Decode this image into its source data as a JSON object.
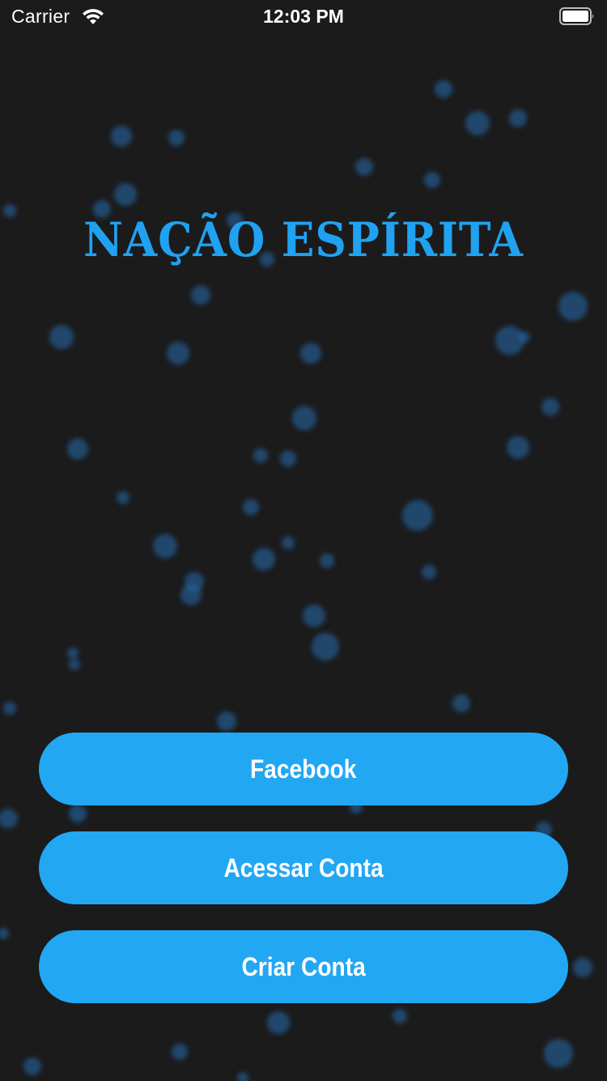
{
  "status_bar": {
    "carrier": "Carrier",
    "time": "12:03 PM",
    "wifi_icon": "wifi-icon",
    "battery_icon": "battery-full-icon"
  },
  "app": {
    "title": "NAÇÃO ESPÍRITA",
    "title_color": "#20a2f1",
    "background_color": "#1b1b1c",
    "button_color": "#22a7f3"
  },
  "buttons": {
    "facebook": "Facebook",
    "login": "Acessar Conta",
    "signup": "Criar Conta"
  }
}
